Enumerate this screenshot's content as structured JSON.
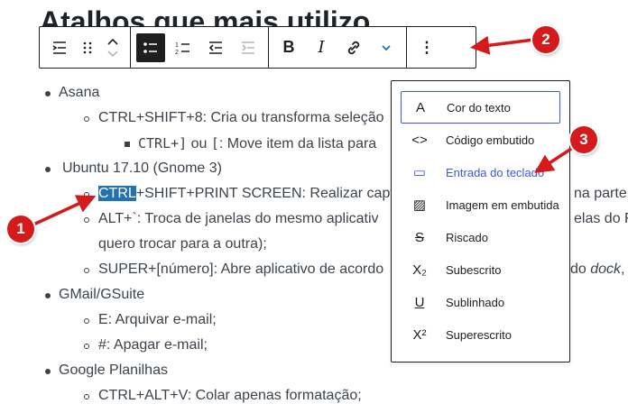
{
  "heading": "Atalhos que mais utilizo",
  "toolbar": {
    "more_label": "⋮"
  },
  "list": {
    "asana": "Asana",
    "asana_1": "CTRL+SHIFT+8: Cria ou transforma seleção",
    "asana_1_1_a": "CTRL+]",
    "asana_1_1_b": " ou ",
    "asana_1_1_c": "[",
    "asana_1_1_d": ": Move item da lista para",
    "ubuntu": "Ubuntu 17.10 (Gnome 3)",
    "ubuntu_1_sel": "CTRL",
    "ubuntu_1_rest": "+SHIFT+PRINT SCREEN: Realizar capt",
    "ubuntu_1_tail": "na parte d",
    "ubuntu_2": "ALT+`: Troca de janelas do mesmo aplicativ",
    "ubuntu_2_tail": "elas do F",
    "ubuntu_2_cont": "quero trocar para a outra);",
    "ubuntu_3": "SUPER+[número]: Abre aplicativo de acordo",
    "ubuntu_3_tail_a": "do ",
    "ubuntu_3_tail_b": "dock",
    "ubuntu_3_tail_c": ",",
    "gmail": "GMail/GSuite",
    "gmail_1": "E: Arquivar e-mail;",
    "gmail_2": "#: Apagar e-mail;",
    "sheets": "Google Planilhas",
    "sheets_1": "CTRL+ALT+V: Colar apenas formatação;"
  },
  "menu": {
    "items": [
      {
        "icon": "A",
        "label": "Cor do texto"
      },
      {
        "icon": "<>",
        "label": "Código embutido"
      },
      {
        "icon": "▭",
        "label": "Entrada do teclado"
      },
      {
        "icon": "▨",
        "label": "Imagem em embutida"
      },
      {
        "icon": "S",
        "label": "Riscado"
      },
      {
        "icon": "X₂",
        "label": "Subescrito"
      },
      {
        "icon": "U",
        "label": "Sublinhado"
      },
      {
        "icon": "X²",
        "label": "Superescrito"
      }
    ]
  },
  "badges": [
    "1",
    "2",
    "3"
  ],
  "colors": {
    "arrow": "#d41a1a",
    "accent": "#3858e9",
    "selection": "#2271b1"
  }
}
